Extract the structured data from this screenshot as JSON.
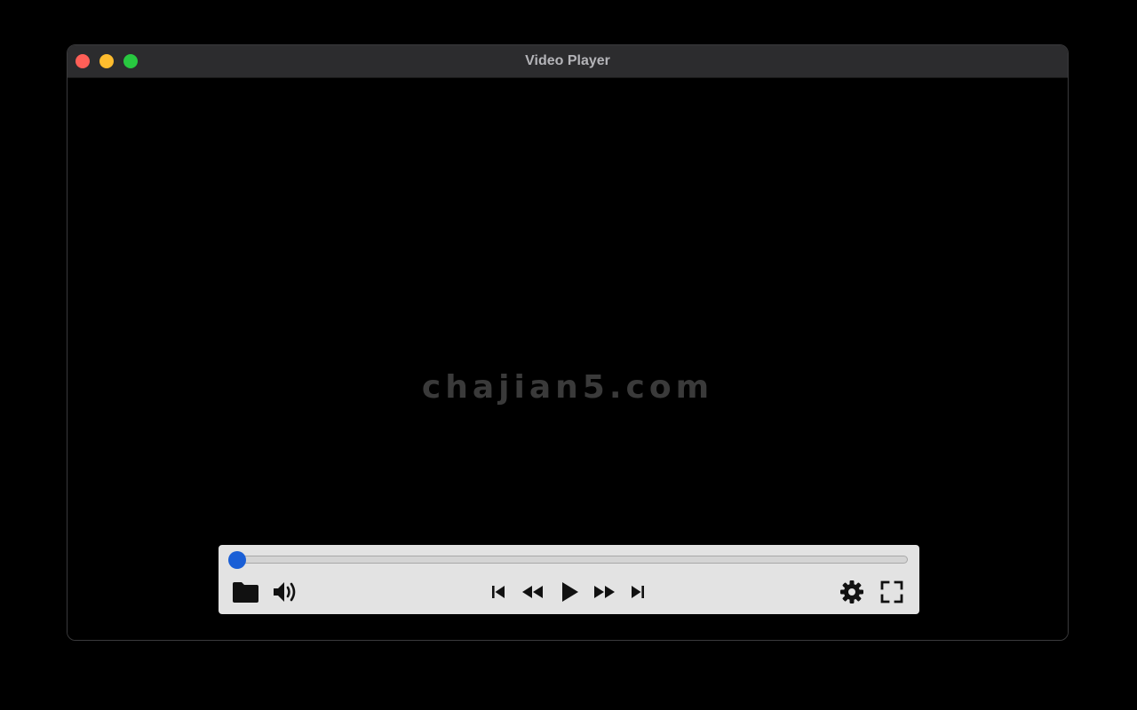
{
  "window": {
    "title": "Video Player"
  },
  "traffic_lights": {
    "close_color": "#ff5f57",
    "minimize_color": "#febc2e",
    "zoom_color": "#28c840"
  },
  "video": {
    "watermark": "chajian5.com"
  },
  "player": {
    "progress_fraction": 0.0,
    "accent_color": "#1a5fd6",
    "icon_color": "#111111",
    "icons": {
      "open": "folder-icon",
      "volume": "speaker-icon",
      "previous": "skip-previous-icon",
      "rewind": "rewind-icon",
      "play": "play-icon",
      "forward": "fast-forward-icon",
      "next": "skip-next-icon",
      "settings": "gear-icon",
      "fullscreen": "fullscreen-icon"
    }
  }
}
